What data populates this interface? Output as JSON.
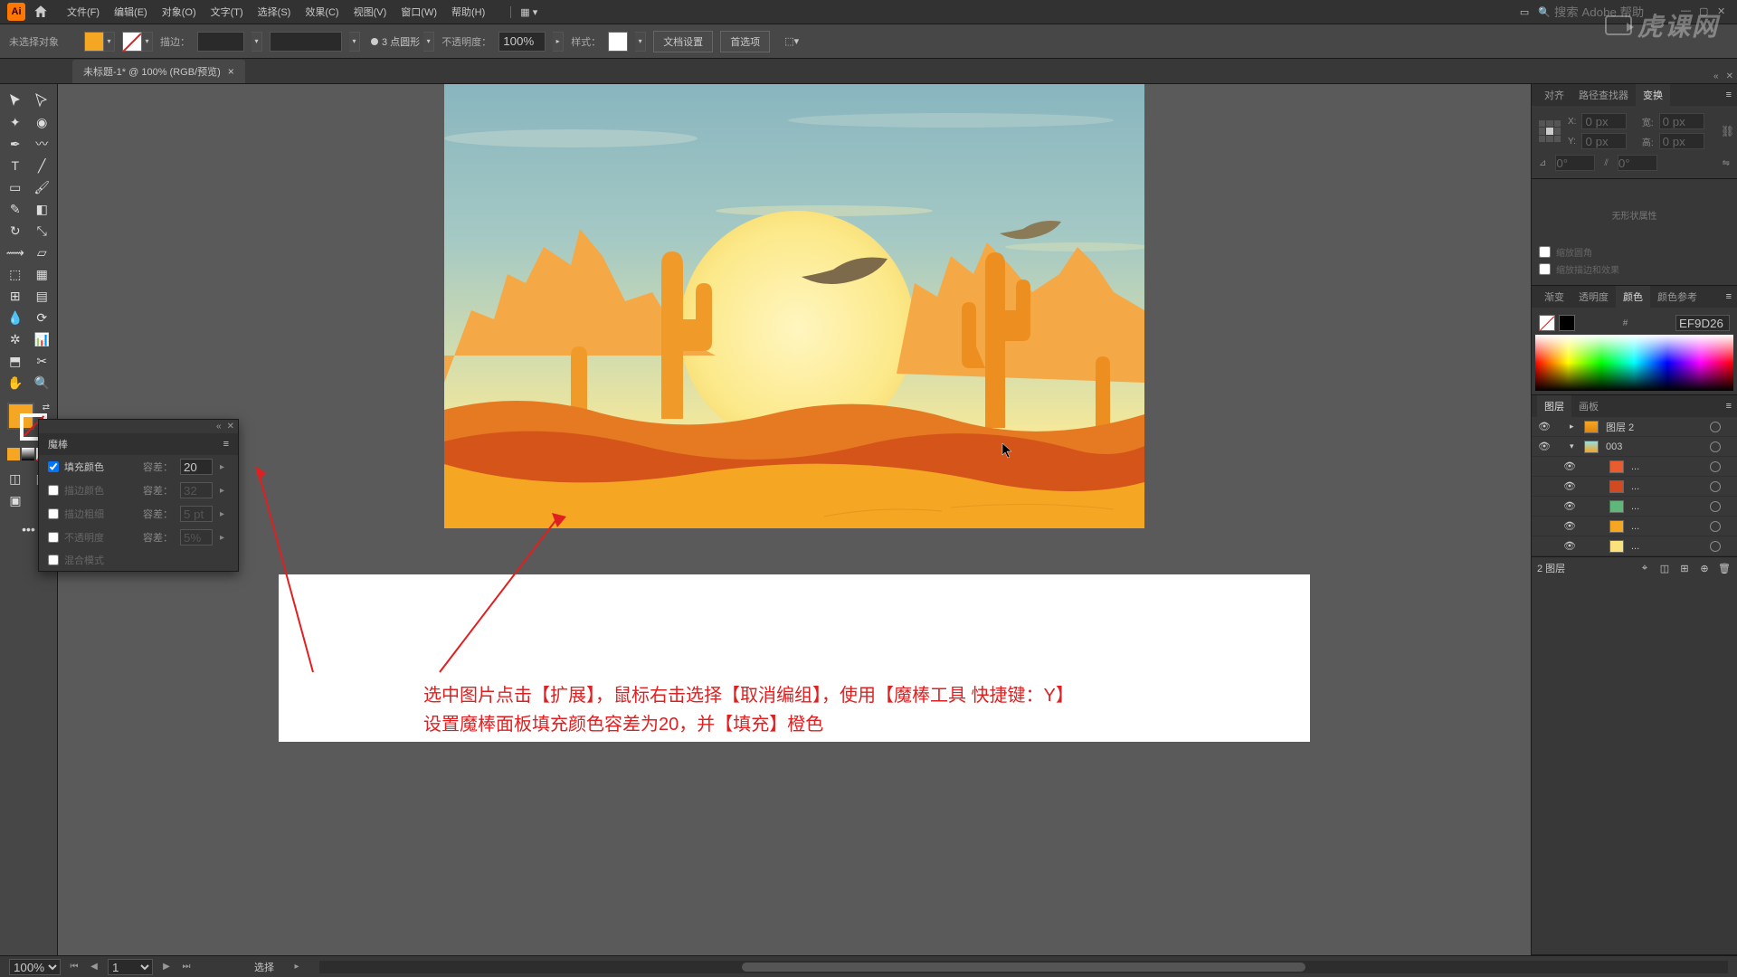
{
  "menubar": {
    "items": [
      "文件(F)",
      "编辑(E)",
      "对象(O)",
      "文字(T)",
      "选择(S)",
      "效果(C)",
      "视图(V)",
      "窗口(W)",
      "帮助(H)"
    ],
    "search_placeholder": "搜索 Adobe 帮助"
  },
  "controlbar": {
    "selection": "未选择对象",
    "stroke_label": "描边：",
    "stroke_weight": "",
    "brush_profile": "3 点圆形",
    "opacity_label": "不透明度：",
    "opacity": "100%",
    "style_label": "样式：",
    "btn_docsetup": "文档设置",
    "btn_prefs": "首选项"
  },
  "tab": {
    "title": "未标题-1* @ 100% (RGB/预览)"
  },
  "wand_panel": {
    "title": "魔棒",
    "fill_color": "填充颜色",
    "fill_checked": true,
    "fill_tol_label": "容差：",
    "fill_tol": "20",
    "stroke_color": "描边颜色",
    "stroke_tol_label": "容差：",
    "stroke_tol": "32",
    "stroke_weight": "描边粗细",
    "sw_tol_label": "容差：",
    "sw_tol": "5 pt",
    "opacity": "不透明度",
    "op_tol_label": "容差：",
    "op_tol": "5%",
    "blend": "混合模式"
  },
  "annotation": {
    "line1": "选中图片点击【扩展】，鼠标右击选择【取消编组】，使用【魔棒工具 快捷键：Y】",
    "line2": "设置魔棒面板填充颜色容差为20，并【填充】橙色"
  },
  "panels": {
    "align_tabs": [
      "对齐",
      "路径查找器",
      "变换"
    ],
    "transform": {
      "x_label": "X:",
      "x": "0 px",
      "y_label": "Y:",
      "y": "0 px",
      "w_label": "宽:",
      "w": "0 px",
      "h_label": "高:",
      "h": "0 px",
      "angle_label": "⊿",
      "angle": "0°",
      "shear_label": "⫽",
      "shear": "0°"
    },
    "no_shape": "无形状属性",
    "cb_scale_corners": "缩放圆角",
    "cb_scale_strokes": "缩放描边和效果",
    "color_tabs": [
      "渐变",
      "透明度",
      "颜色",
      "颜色参考"
    ],
    "color_hex_prefix": "#",
    "color_hex": "EF9D26",
    "layer_tabs": [
      "图层",
      "画板"
    ],
    "layers": [
      {
        "level": 0,
        "exp": "▸",
        "name": "图层 2",
        "thumb": "linear-gradient(#f5a623,#e08510)"
      },
      {
        "level": 0,
        "exp": "▾",
        "name": "003",
        "thumb": "linear-gradient(#9dd,#f5a623)"
      },
      {
        "level": 1,
        "name": "...",
        "thumb": "#e85c2e"
      },
      {
        "level": 1,
        "name": "...",
        "thumb": "#d24a1f"
      },
      {
        "level": 1,
        "name": "...",
        "thumb": "#5fb87a"
      },
      {
        "level": 1,
        "name": "...",
        "thumb": "#f5a623"
      },
      {
        "level": 1,
        "name": "...",
        "thumb": "#f9e27d"
      }
    ],
    "layers_footer": "2 图层"
  },
  "statusbar": {
    "zoom": "100%",
    "page": "1",
    "mode": "选择"
  },
  "colors": {
    "fill": "#f5a623"
  },
  "watermark": "虎课网"
}
